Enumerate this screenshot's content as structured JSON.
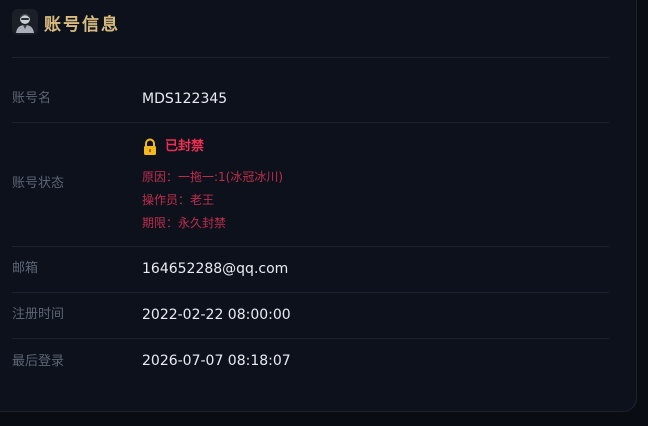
{
  "header": {
    "title": "账号信息",
    "avatar_icon": "user-avatar-icon"
  },
  "fields": {
    "account_name": {
      "label": "账号名",
      "value": "MDS122345"
    },
    "account_status": {
      "label": "账号状态",
      "status": "已封禁",
      "status_icon": "lock-icon",
      "reason": "原因：一拖一:1(冰冠冰川)",
      "operator": "操作员：老王",
      "duration": "期限：永久封禁"
    },
    "email": {
      "label": "邮箱",
      "value": "164652288@qq.com"
    },
    "register_time": {
      "label": "注册时间",
      "value": "2022-02-22 08:00:00"
    },
    "last_login": {
      "label": "最后登录",
      "value": "2026-07-07 08:18:07"
    }
  },
  "colors": {
    "title": "#d9bb80",
    "status_banned": "#ef2f52",
    "detail_text": "#bf2d4d",
    "label_text": "#5d6474",
    "value_text": "#e8ebf0",
    "lock_icon": "#f5b81c"
  }
}
